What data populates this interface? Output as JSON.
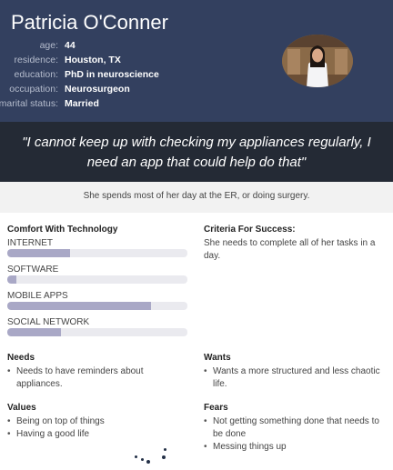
{
  "persona": {
    "name": "Patricia O'Conner",
    "facts": [
      {
        "label": "age:",
        "value": "44"
      },
      {
        "label": "residence:",
        "value": "Houston, TX"
      },
      {
        "label": "education:",
        "value": "PhD in neuroscience"
      },
      {
        "label": "occupation:",
        "value": "Neurosurgeon"
      },
      {
        "label": "marital status:",
        "value": "Married"
      }
    ],
    "photo_icon": "person-photo",
    "quote": "\"I cannot keep up with checking my appliances regularly, I need an app that could help do that\"",
    "summary": "She spends most of her day at the ER, or doing surgery."
  },
  "comfort": {
    "title": "Comfort With Technology",
    "items": [
      {
        "label": "INTERNET",
        "level": 0.35
      },
      {
        "label": "SOFTWARE",
        "level": 0.05
      },
      {
        "label": "MOBILE APPS",
        "level": 0.8
      },
      {
        "label": "SOCIAL NETWORK",
        "level": 0.3
      }
    ]
  },
  "criteria": {
    "title": "Criteria For Success:",
    "text": "She needs to complete all of her tasks in a day."
  },
  "needs": {
    "title": "Needs",
    "items": [
      "Needs to have reminders about appliances."
    ]
  },
  "wants": {
    "title": "Wants",
    "items": [
      "Wants a more structured and less chaotic life."
    ]
  },
  "values": {
    "title": "Values",
    "items": [
      "Being on top of things",
      "Having a good life"
    ]
  },
  "fears": {
    "title": "Fears",
    "items": [
      "Not getting something done that needs to be done",
      "Messing things up"
    ]
  },
  "colors": {
    "header_bg": "#33405f",
    "quote_bg": "#242a35",
    "bar_fill": "#a9a8c6",
    "bar_track": "#eaeaef"
  }
}
